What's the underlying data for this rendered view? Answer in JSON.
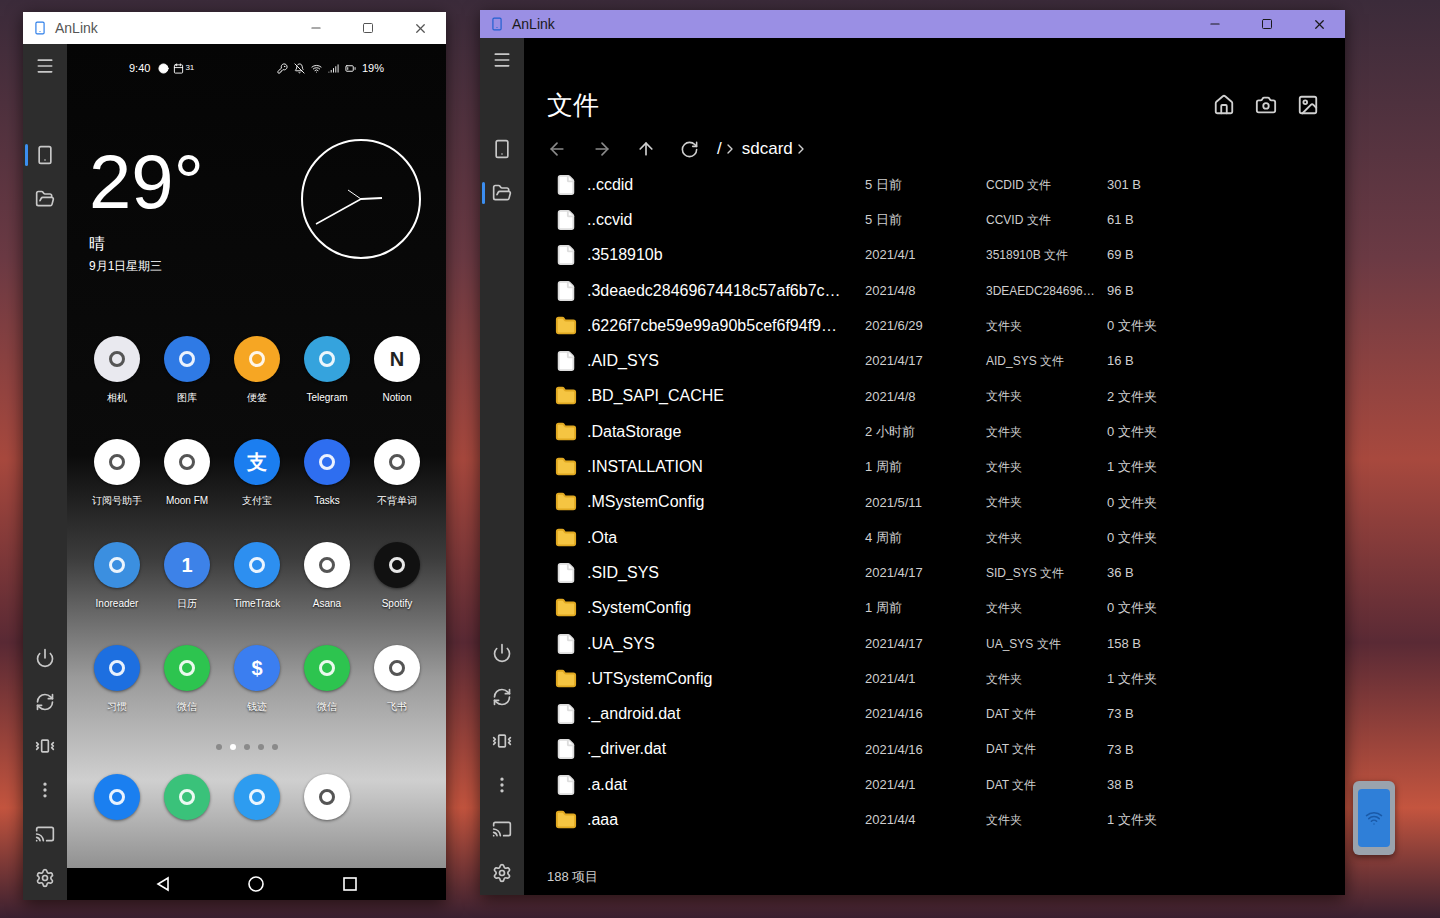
{
  "phone_window": {
    "title": "AnLink",
    "nav": [
      {
        "selected": true
      },
      {
        "selected": false
      }
    ],
    "status_bar": {
      "time": "9:40",
      "calendar_day": "31",
      "battery": "19%"
    },
    "weather": {
      "temperature": "29°",
      "condition": "晴",
      "date": "9月1日星期三"
    },
    "apps": [
      {
        "label": "相机",
        "color": "#e9e9ef",
        "glyph": ""
      },
      {
        "label": "图库",
        "color": "#2f7ae5",
        "glyph": ""
      },
      {
        "label": "便签",
        "color": "#f6a623",
        "glyph": ""
      },
      {
        "label": "Telegram",
        "color": "#35a3dd",
        "glyph": ""
      },
      {
        "label": "Notion",
        "color": "#ffffff",
        "glyph": "N"
      },
      {
        "label": "订阅号助手",
        "color": "#ffffff",
        "glyph": ""
      },
      {
        "label": "Moon FM",
        "color": "#ffffff",
        "glyph": ""
      },
      {
        "label": "支付宝",
        "color": "#1b7ef0",
        "glyph": "支"
      },
      {
        "label": "Tasks",
        "color": "#2e6ef0",
        "glyph": ""
      },
      {
        "label": "不背单词",
        "color": "#ffffff",
        "glyph": ""
      },
      {
        "label": "Inoreader",
        "color": "#3b8fe0",
        "glyph": ""
      },
      {
        "label": "日历",
        "color": "#3d82e8",
        "glyph": "1"
      },
      {
        "label": "TimeTrack",
        "color": "#2d8ff0",
        "glyph": ""
      },
      {
        "label": "Asana",
        "color": "#ffffff",
        "glyph": ""
      },
      {
        "label": "Spotify",
        "color": "#111111",
        "glyph": ""
      },
      {
        "label": "习惯",
        "color": "#1d6fe0",
        "glyph": ""
      },
      {
        "label": "微信",
        "color": "#2dc44f",
        "glyph": ""
      },
      {
        "label": "钱迹",
        "color": "#3b7ef0",
        "glyph": "$"
      },
      {
        "label": "微信",
        "color": "#2dc44f",
        "glyph": ""
      },
      {
        "label": "飞书",
        "color": "#ffffff",
        "glyph": ""
      }
    ],
    "page_dots": [
      {
        "selected": false
      },
      {
        "selected": true
      },
      {
        "selected": false
      },
      {
        "selected": false
      },
      {
        "selected": false
      }
    ],
    "dock": [
      {
        "color": "#1a7ff0"
      },
      {
        "color": "#3ac27a"
      },
      {
        "color": "#2d9cf0"
      },
      {
        "color": "#ffffff"
      }
    ]
  },
  "files_window": {
    "title": "AnLink",
    "nav": [
      {
        "selected": false
      },
      {
        "selected": true
      }
    ],
    "heading": "文件",
    "path": {
      "root": "/",
      "segments": [
        "sdcard"
      ]
    },
    "rows": [
      {
        "name": "..ccdid",
        "modified": "5 日前",
        "type": "CCDID 文件",
        "size": "301 B",
        "kind": "file"
      },
      {
        "name": "..ccvid",
        "modified": "5 日前",
        "type": "CCVID 文件",
        "size": "61 B",
        "kind": "file"
      },
      {
        "name": ".3518910b",
        "modified": "2021/4/1",
        "type": "3518910B 文件",
        "size": "69 B",
        "kind": "file"
      },
      {
        "name": ".3deaedc28469674418c57af6b7c…",
        "modified": "2021/4/8",
        "type": "3DEAEDC284696…",
        "size": "96 B",
        "kind": "file"
      },
      {
        "name": ".6226f7cbe59e99a90b5cef6f94f9…",
        "modified": "2021/6/29",
        "type": "文件夹",
        "size": "0 文件夹",
        "kind": "folder"
      },
      {
        "name": ".AID_SYS",
        "modified": "2021/4/17",
        "type": "AID_SYS 文件",
        "size": "16 B",
        "kind": "file"
      },
      {
        "name": ".BD_SAPI_CACHE",
        "modified": "2021/4/8",
        "type": "文件夹",
        "size": "2 文件夹",
        "kind": "folder"
      },
      {
        "name": ".DataStorage",
        "modified": "2 小时前",
        "type": "文件夹",
        "size": "0 文件夹",
        "kind": "folder"
      },
      {
        "name": ".INSTALLATION",
        "modified": "1 周前",
        "type": "文件夹",
        "size": "1 文件夹",
        "kind": "folder"
      },
      {
        "name": ".MSystemConfig",
        "modified": "2021/5/11",
        "type": "文件夹",
        "size": "0 文件夹",
        "kind": "folder"
      },
      {
        "name": ".Ota",
        "modified": "4 周前",
        "type": "文件夹",
        "size": "0 文件夹",
        "kind": "folder"
      },
      {
        "name": ".SID_SYS",
        "modified": "2021/4/17",
        "type": "SID_SYS 文件",
        "size": "36 B",
        "kind": "file"
      },
      {
        "name": ".SystemConfig",
        "modified": "1 周前",
        "type": "文件夹",
        "size": "0 文件夹",
        "kind": "folder"
      },
      {
        "name": ".UA_SYS",
        "modified": "2021/4/17",
        "type": "UA_SYS 文件",
        "size": "158 B",
        "kind": "file"
      },
      {
        "name": ".UTSystemConfig",
        "modified": "2021/4/1",
        "type": "文件夹",
        "size": "1 文件夹",
        "kind": "folder"
      },
      {
        "name": "._android.dat",
        "modified": "2021/4/16",
        "type": "DAT 文件",
        "size": "73 B",
        "kind": "file"
      },
      {
        "name": "._driver.dat",
        "modified": "2021/4/16",
        "type": "DAT 文件",
        "size": "73 B",
        "kind": "file"
      },
      {
        "name": ".a.dat",
        "modified": "2021/4/1",
        "type": "DAT 文件",
        "size": "38 B",
        "kind": "file"
      },
      {
        "name": ".aaa",
        "modified": "2021/4/4",
        "type": "文件夹",
        "size": "1 文件夹",
        "kind": "folder"
      }
    ],
    "footer": "188 项目"
  }
}
